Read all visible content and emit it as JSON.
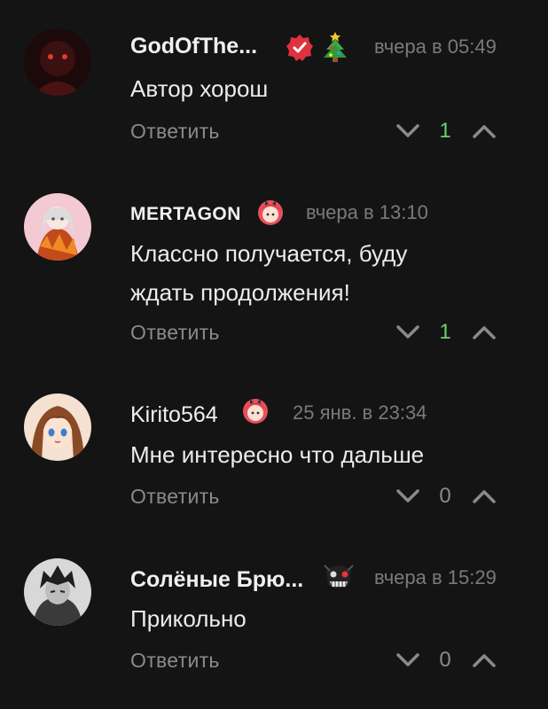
{
  "comments": [
    {
      "author": "GodOfThe...",
      "time": "вчера в 05:49",
      "text": "Автор хорош",
      "reply_label": "Ответить",
      "votes": "1"
    },
    {
      "author": "MERTAGON",
      "time": "вчера в 13:10",
      "text_line1": "Классно получается, буду",
      "text_line2": "ждать продолжения!",
      "reply_label": "Ответить",
      "votes": "1"
    },
    {
      "author": "Kirito564",
      "time": "25 янв. в 23:34",
      "text": "Мне интересно что дальше",
      "reply_label": "Ответить",
      "votes": "0"
    },
    {
      "author": "Солёные Брю...",
      "time": "вчера в 15:29",
      "text": "Прикольно",
      "reply_label": "Ответить",
      "votes": "0"
    }
  ],
  "colors": {
    "background": "#141414",
    "positive_votes": "#6fcf6b",
    "muted": "#7a7a7a",
    "verified_badge": "#e0323c"
  },
  "icons": [
    "verified-badge-icon",
    "christmas-tree-icon",
    "anime-girl-sticker-icon",
    "mask-sticker-icon",
    "chevron-down-icon",
    "chevron-up-icon"
  ]
}
